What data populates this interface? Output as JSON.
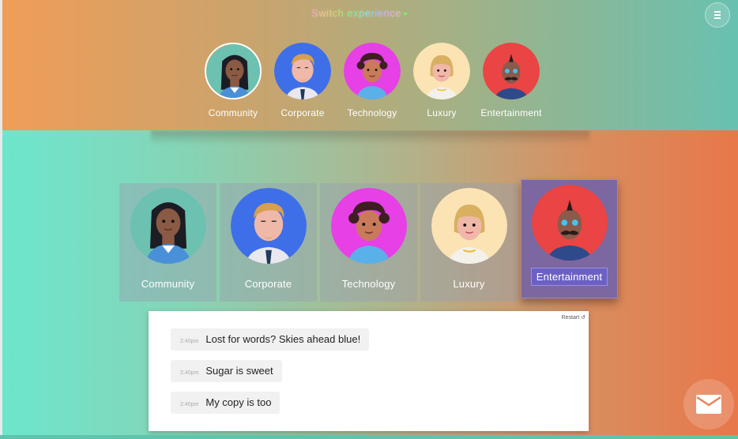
{
  "header": {
    "switch_label": "Switch experience",
    "menu_icon": "hamburger-menu-icon"
  },
  "top_avatars": [
    {
      "label": "Community",
      "selected": true,
      "bg": "#6cc1b0"
    },
    {
      "label": "Corporate",
      "selected": false,
      "bg": "#3f6fe8"
    },
    {
      "label": "Technology",
      "selected": false,
      "bg": "#e640e6"
    },
    {
      "label": "Luxury",
      "selected": false,
      "bg": "#fbe3b4"
    },
    {
      "label": "Entertainment",
      "selected": false,
      "bg": "#ea4444"
    }
  ],
  "cards": [
    {
      "label": "Community",
      "active": false,
      "bg": "#6cc1b0"
    },
    {
      "label": "Corporate",
      "active": false,
      "bg": "#3f6fe8"
    },
    {
      "label": "Technology",
      "active": false,
      "bg": "#e640e6"
    },
    {
      "label": "Luxury",
      "active": false,
      "bg": "#fbe3b4"
    },
    {
      "label": "Entertainment",
      "active": true,
      "bg": "#ea4444"
    }
  ],
  "chat": {
    "restart_label": "Restart",
    "messages": [
      {
        "time": "2:40pm",
        "text": "Lost for words? Skies ahead blue!"
      },
      {
        "time": "2:40pm",
        "text": "Sugar is sweet"
      },
      {
        "time": "2:40pm",
        "text": "My copy is too"
      }
    ]
  },
  "contact": {
    "icon": "envelope-icon"
  }
}
